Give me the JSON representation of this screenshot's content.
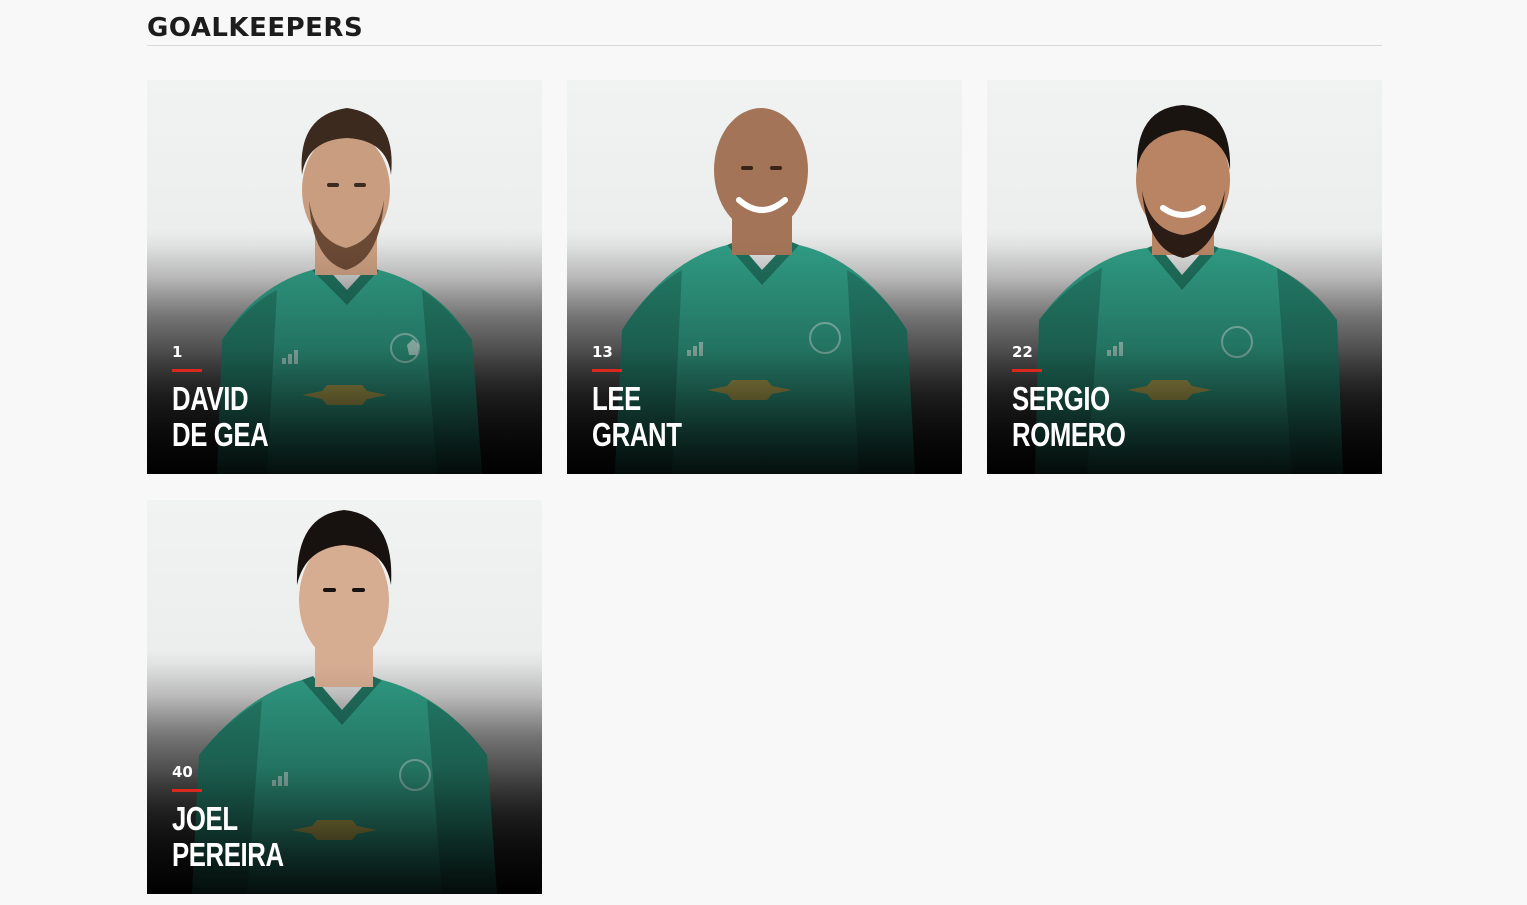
{
  "section": {
    "title": "GOALKEEPERS"
  },
  "players": [
    {
      "number": "1",
      "first_name": "DAVID",
      "last_name": "DE GEA",
      "hair": "#3b2a1d",
      "skin": "#c99d80",
      "beard": true
    },
    {
      "number": "13",
      "first_name": "LEE",
      "last_name": "GRANT",
      "hair": "none",
      "skin": "#a47458",
      "beard": false
    },
    {
      "number": "22",
      "first_name": "SERGIO",
      "last_name": "ROMERO",
      "hair": "#1a1411",
      "skin": "#b88464",
      "beard": true
    },
    {
      "number": "40",
      "first_name": "JOEL",
      "last_name": "PEREIRA",
      "hair": "#17120f",
      "skin": "#d7ad92",
      "beard": false
    }
  ],
  "colors": {
    "background": "#f8f8f8",
    "accent_red": "#da291c",
    "kit_green": "#2f9a82",
    "kit_dark": "#0e4a3d",
    "sponsor_gold": "#c9a84a"
  },
  "icons": {
    "crest": "club-crest-icon",
    "sponsor": "bowtie-sponsor-icon",
    "kit_maker": "three-stripes-icon"
  }
}
